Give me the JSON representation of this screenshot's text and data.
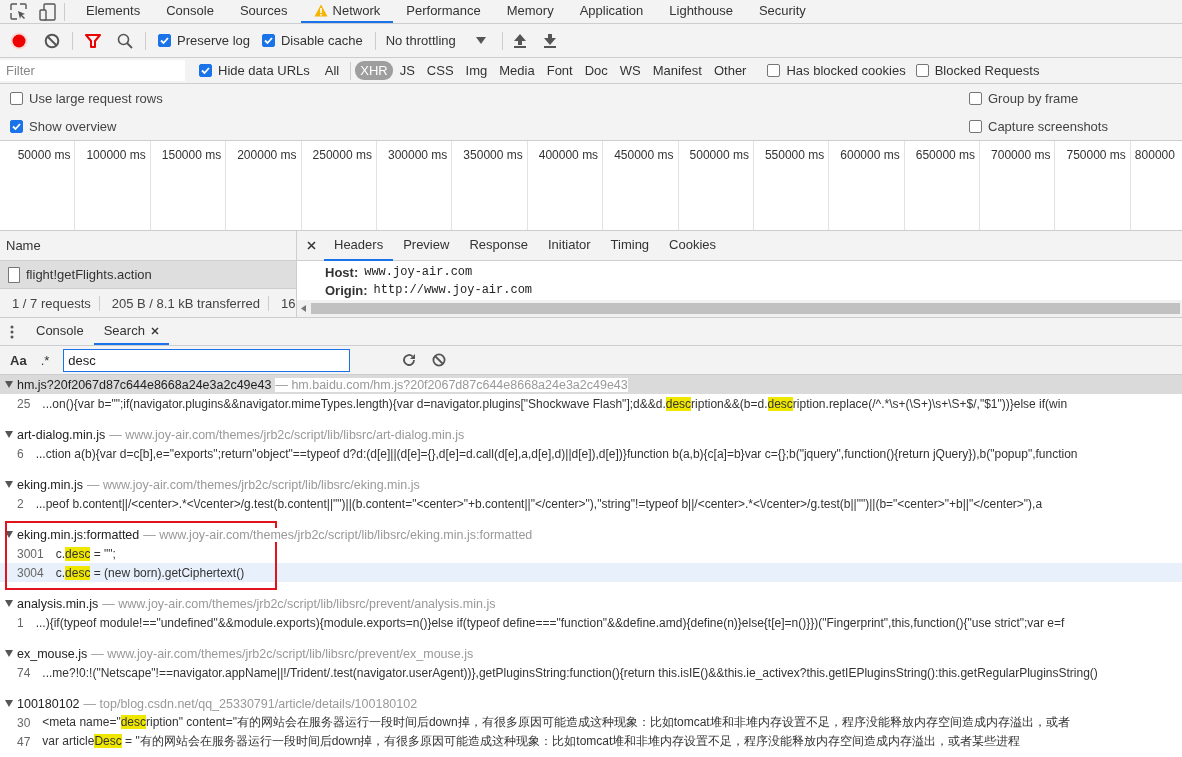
{
  "main_tabs": [
    {
      "label": "Elements",
      "selected": false,
      "warning": false
    },
    {
      "label": "Console",
      "selected": false,
      "warning": false
    },
    {
      "label": "Sources",
      "selected": false,
      "warning": false
    },
    {
      "label": "Network",
      "selected": true,
      "warning": true
    },
    {
      "label": "Performance",
      "selected": false,
      "warning": false
    },
    {
      "label": "Memory",
      "selected": false,
      "warning": false
    },
    {
      "label": "Application",
      "selected": false,
      "warning": false
    },
    {
      "label": "Lighthouse",
      "selected": false,
      "warning": false
    },
    {
      "label": "Security",
      "selected": false,
      "warning": false
    }
  ],
  "toolbar": {
    "recording": true,
    "filter_active": true,
    "preserve_log": {
      "label": "Preserve log",
      "checked": true
    },
    "disable_cache": {
      "label": "Disable cache",
      "checked": true
    },
    "throttling": "No throttling"
  },
  "filter_bar": {
    "placeholder": "Filter",
    "hide_data_urls": {
      "label": "Hide data URLs",
      "checked": true
    },
    "types": [
      {
        "label": "All",
        "selected": false
      },
      {
        "label": "XHR",
        "selected": true
      },
      {
        "label": "JS",
        "selected": false
      },
      {
        "label": "CSS",
        "selected": false
      },
      {
        "label": "Img",
        "selected": false
      },
      {
        "label": "Media",
        "selected": false
      },
      {
        "label": "Font",
        "selected": false
      },
      {
        "label": "Doc",
        "selected": false
      },
      {
        "label": "WS",
        "selected": false
      },
      {
        "label": "Manifest",
        "selected": false
      },
      {
        "label": "Other",
        "selected": false
      }
    ],
    "has_blocked_cookies": {
      "label": "Has blocked cookies",
      "checked": false
    },
    "blocked_requests": {
      "label": "Blocked Requests",
      "checked": false
    }
  },
  "options_left": [
    {
      "label": "Use large request rows",
      "checked": false
    },
    {
      "label": "Show overview",
      "checked": true
    }
  ],
  "options_right": [
    {
      "label": "Group by frame",
      "checked": false
    },
    {
      "label": "Capture screenshots",
      "checked": false
    }
  ],
  "overview": {
    "ticks": [
      "50000 ms",
      "100000 ms",
      "150000 ms",
      "200000 ms",
      "250000 ms",
      "300000 ms",
      "350000 ms",
      "400000 ms",
      "450000 ms",
      "500000 ms",
      "550000 ms",
      "600000 ms",
      "650000 ms",
      "700000 ms",
      "750000 ms",
      "800000"
    ]
  },
  "requests": {
    "column": "Name",
    "rows": [
      {
        "name": "flight!getFlights.action",
        "selected": true
      }
    ],
    "summary": [
      "1 / 7 requests",
      "205 B / 8.1 kB transferred",
      "16"
    ]
  },
  "details": {
    "tabs": [
      {
        "label": "Headers",
        "selected": true
      },
      {
        "label": "Preview",
        "selected": false
      },
      {
        "label": "Response",
        "selected": false
      },
      {
        "label": "Initiator",
        "selected": false
      },
      {
        "label": "Timing",
        "selected": false
      },
      {
        "label": "Cookies",
        "selected": false
      }
    ],
    "headers": [
      {
        "name": "Host:",
        "value": "www.joy-air.com"
      },
      {
        "name": "Origin:",
        "value": "http://www.joy-air.com"
      }
    ]
  },
  "drawer": {
    "tabs": [
      {
        "label": "Console",
        "selected": false,
        "closable": false
      },
      {
        "label": "Search",
        "selected": true,
        "closable": true
      }
    ],
    "match_case": "Aa",
    "regex": ".*",
    "search_value": "desc",
    "results": [
      {
        "file": "hm.js?20f2067d87c644e8668a24e3a2c49e43",
        "url": "— hm.baidu.com/hm.js?20f2067d87c644e8668a24e3a2c49e43",
        "expanded": true,
        "selected": true,
        "highlighted": false,
        "lines": [
          {
            "number": "25",
            "selected": false,
            "segments": [
              {
                "text": "...on(){var b=\"\";if(navigator.plugins&&navigator.mimeTypes.length){var d=navigator.plugins[\"Shockwave Flash\"];d&&d.",
                "match": false
              },
              {
                "text": "desc",
                "match": true
              },
              {
                "text": "ription&&(b=d.",
                "match": false
              },
              {
                "text": "desc",
                "match": true
              },
              {
                "text": "ription.replace(/^.*\\s+(\\S+)\\s+\\S+$/,\"$1\"))}else if(win",
                "match": false
              }
            ]
          }
        ]
      },
      {
        "file": "art-dialog.min.js",
        "url": "— www.joy-air.com/themes/jrb2c/script/lib/libsrc/art-dialog.min.js",
        "expanded": true,
        "selected": false,
        "highlighted": false,
        "lines": [
          {
            "number": "6",
            "selected": false,
            "segments": [
              {
                "text": "...ction a(b){var d=c[b],e=\"exports\";return\"object\"==typeof d?d:(d[e]||(d[e]={},d[e]=d.call(d[e],a,d[e],d)||d[e]),d[e])}function b(a,b){c[a]=b}var c={};b(\"jquery\",function(){return jQuery}),b(\"popup\",function",
                "match": false
              }
            ]
          }
        ]
      },
      {
        "file": "eking.min.js",
        "url": "— www.joy-air.com/themes/jrb2c/script/lib/libsrc/eking.min.js",
        "expanded": true,
        "selected": false,
        "highlighted": false,
        "lines": [
          {
            "number": "2",
            "selected": false,
            "segments": [
              {
                "text": "...peof b.content||/<center>.*<\\/center>/g.test(b.content||\"\")||(b.content=\"<center>\"+b.content||\"</center>\"),\"string\"!=typeof b||/<center>.*<\\/center>/g.test(b||\"\")||(b=\"<center>\"+b||\"</center>\"),a",
                "match": false
              }
            ]
          }
        ]
      },
      {
        "file": "eking.min.js:formatted",
        "url": "— www.joy-air.com/themes/jrb2c/script/lib/libsrc/eking.min.js:formatted",
        "expanded": true,
        "selected": false,
        "highlighted": true,
        "lines": [
          {
            "number": "3001",
            "selected": false,
            "segments": [
              {
                "text": "c.",
                "match": false
              },
              {
                "text": "desc",
                "match": true
              },
              {
                "text": " = \"\";",
                "match": false
              }
            ]
          },
          {
            "number": "3004",
            "selected": true,
            "segments": [
              {
                "text": "c.",
                "match": false
              },
              {
                "text": "desc",
                "match": true
              },
              {
                "text": " = (new born).getCiphertext()",
                "match": false
              }
            ]
          }
        ]
      },
      {
        "file": "analysis.min.js",
        "url": "— www.joy-air.com/themes/jrb2c/script/lib/libsrc/prevent/analysis.min.js",
        "expanded": true,
        "selected": false,
        "highlighted": false,
        "lines": [
          {
            "number": "1",
            "selected": false,
            "segments": [
              {
                "text": "...){if(typeof module!==\"undefined\"&&module.exports){module.exports=n()}else if(typeof define===\"function\"&&define.amd){define(n)}else{t[e]=n()}})(\"Fingerprint\",this,function(){\"use strict\";var e=f",
                "match": false
              }
            ]
          }
        ]
      },
      {
        "file": "ex_mouse.js",
        "url": "— www.joy-air.com/themes/jrb2c/script/lib/libsrc/prevent/ex_mouse.js",
        "expanded": true,
        "selected": false,
        "highlighted": false,
        "lines": [
          {
            "number": "74",
            "selected": false,
            "segments": [
              {
                "text": "...me?!0:!(\"Netscape\"!==navigator.appName||!/Trident/.test(navigator.userAgent))},getPluginsString:function(){return this.isIE()&&this.ie_activex?this.getIEPluginsString():this.getRegularPluginsString()",
                "match": false
              }
            ]
          }
        ]
      },
      {
        "file": "100180102",
        "url": "— top/blog.csdn.net/qq_25330791/article/details/100180102",
        "expanded": true,
        "selected": false,
        "highlighted": false,
        "lines": [
          {
            "number": "30",
            "selected": false,
            "segments": [
              {
                "text": "<meta name=\"",
                "match": false
              },
              {
                "text": "desc",
                "match": true
              },
              {
                "text": "ription\" content=\"有的网站会在服务器运行一段时间后down掉，有很多原因可能造成这种现象：比如tomcat堆和非堆内存设置不足，程序没能释放内存空间造成内存溢出，或者",
                "match": false
              }
            ]
          },
          {
            "number": "47",
            "selected": false,
            "segments": [
              {
                "text": "var article",
                "match": false
              },
              {
                "text": "Desc",
                "match": true
              },
              {
                "text": " = \"有的网站会在服务器运行一段时间后down掉，有很多原因可能造成这种现象：比如tomcat堆和非堆内存设置不足，程序没能释放内存空间造成内存溢出，或者某些进程",
                "match": false
              }
            ]
          }
        ]
      }
    ]
  }
}
